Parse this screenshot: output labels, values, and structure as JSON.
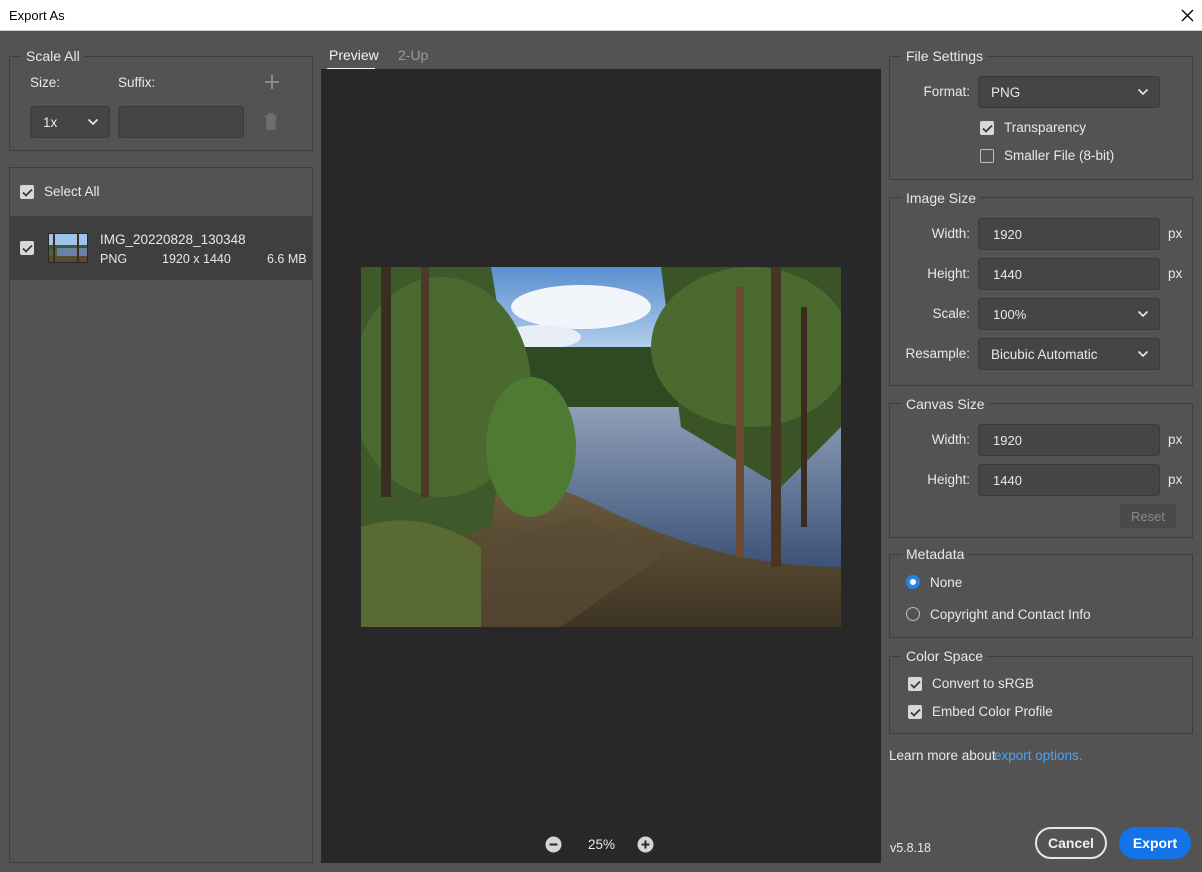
{
  "window": {
    "title": "Export As",
    "close_icon": "close-icon"
  },
  "scale_all": {
    "heading": "Scale All",
    "size_label": "Size:",
    "suffix_label": "Suffix:",
    "size_value": "1x",
    "suffix_value": ""
  },
  "file_list": {
    "select_all_label": "Select All",
    "items": [
      {
        "name": "IMG_20220828_130348",
        "format": "PNG",
        "dimensions": "1920 x 1440",
        "size": "6.6 MB"
      }
    ]
  },
  "preview": {
    "tabs": [
      "Preview",
      "2-Up"
    ],
    "zoom": "25%"
  },
  "file_settings": {
    "heading": "File Settings",
    "format_label": "Format:",
    "format_value": "PNG",
    "transparency_label": "Transparency",
    "smaller_file_label": "Smaller File (8-bit)"
  },
  "image_size": {
    "heading": "Image Size",
    "width_label": "Width:",
    "width_value": "1920",
    "height_label": "Height:",
    "height_value": "1440",
    "scale_label": "Scale:",
    "scale_value": "100%",
    "resample_label": "Resample:",
    "resample_value": "Bicubic Automatic",
    "unit": "px"
  },
  "canvas_size": {
    "heading": "Canvas Size",
    "width_label": "Width:",
    "width_value": "1920",
    "height_label": "Height:",
    "height_value": "1440",
    "unit": "px",
    "reset_label": "Reset"
  },
  "metadata": {
    "heading": "Metadata",
    "none_label": "None",
    "copyright_label": "Copyright and Contact Info"
  },
  "color_space": {
    "heading": "Color Space",
    "convert_label": "Convert to sRGB",
    "embed_label": "Embed Color Profile"
  },
  "footer": {
    "learn_more_text": "Learn more about",
    "learn_more_link": "export options.",
    "version": "v5.8.18",
    "cancel_label": "Cancel",
    "export_label": "Export"
  },
  "colors": {
    "accent": "#1473e6",
    "link": "#4ba3f2",
    "panel_bg": "#535353",
    "preview_bg": "#282828"
  }
}
